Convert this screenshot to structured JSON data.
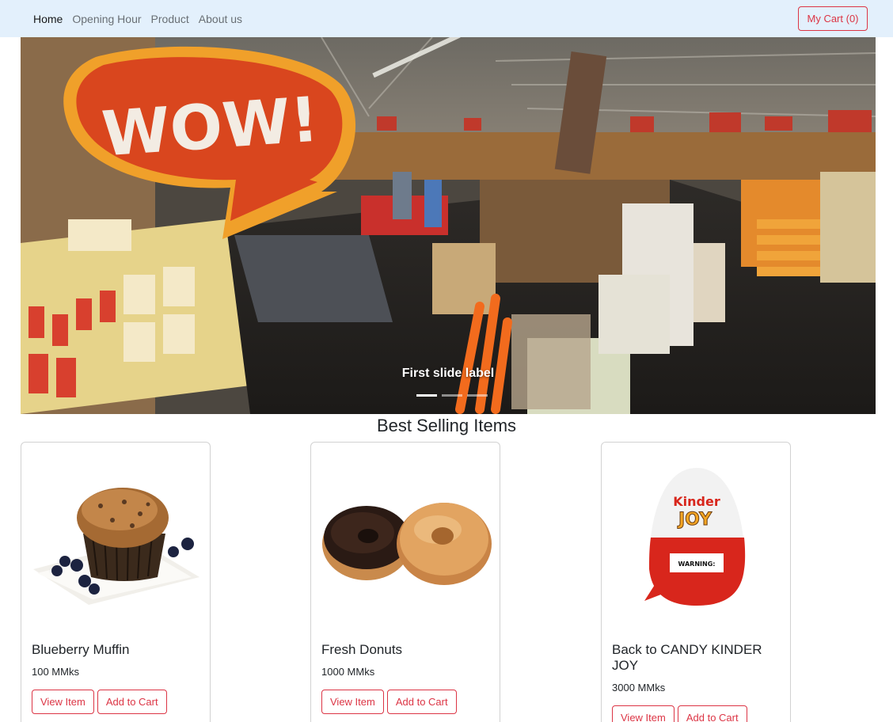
{
  "nav": {
    "links": [
      "Home",
      "Opening Hour",
      "Product",
      "About us"
    ],
    "cart_label": "My Cart (0)"
  },
  "carousel": {
    "caption": "First slide label",
    "sign_text": "WOW!",
    "indicator_count": 3,
    "active_index": 0
  },
  "section": {
    "title": "Best Selling Items"
  },
  "products": [
    {
      "name": "Blueberry Muffin",
      "price": "100 MMks",
      "view_label": "View Item",
      "add_label": "Add to Cart",
      "image": "muffin"
    },
    {
      "name": "Fresh Donuts",
      "price": "1000 MMks",
      "view_label": "View Item",
      "add_label": "Add to Cart",
      "image": "donuts"
    },
    {
      "name": "Back to CANDY KINDER JOY",
      "price": "3000 MMks",
      "view_label": "View Item",
      "add_label": "Add to Cart",
      "image": "kinder-egg"
    }
  ],
  "kinder_packaging": {
    "brand": "Kinder",
    "product": "JOY",
    "warning": "WARNING:"
  },
  "colors": {
    "navbar_bg": "#e3f0fc",
    "accent": "#dc3545"
  }
}
